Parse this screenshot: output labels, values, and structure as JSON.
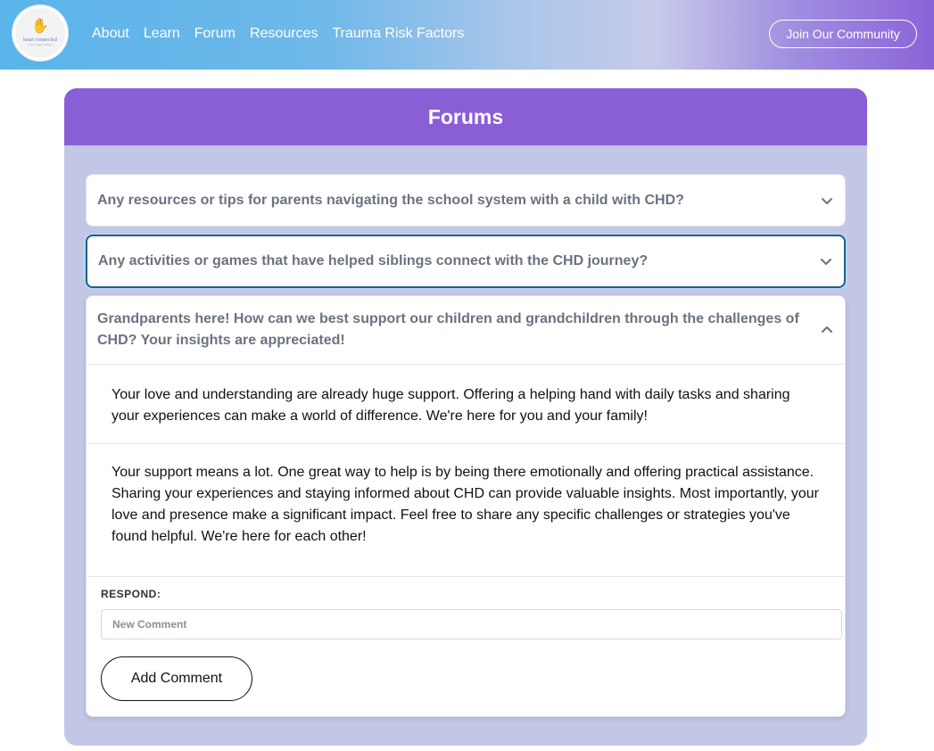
{
  "header": {
    "logo_text": "heart connected",
    "logo_sub": "every heart matters",
    "nav": [
      "About",
      "Learn",
      "Forum",
      "Resources",
      "Trauma Risk Factors"
    ],
    "join_label": "Join Our Community"
  },
  "forums": {
    "title": "Forums",
    "questions": [
      {
        "text": "Any resources or tips for parents navigating the school system with a child with CHD?",
        "expanded": false
      },
      {
        "text": "Any activities or games that have helped siblings connect with the CHD journey?",
        "expanded": false
      },
      {
        "text": "Grandparents here! How can we best support our children and grandchildren through the challenges of CHD? Your insights are appreciated!",
        "expanded": true
      }
    ],
    "comments": [
      "Your love and understanding are already huge support. Offering a helping hand with daily tasks and sharing your experiences can make a world of difference. We're here for you and your family!",
      "Your support means a lot. One great way to help is by being there emotionally and offering practical assistance. Sharing your experiences and staying informed about CHD can provide valuable insights. Most importantly, your love and presence make a significant impact. Feel free to share any specific challenges or strategies you've found helpful. We're here for each other!"
    ],
    "respond_label": "RESPOND:",
    "comment_placeholder": "New Comment",
    "comment_value": "",
    "add_button": "Add Comment"
  }
}
